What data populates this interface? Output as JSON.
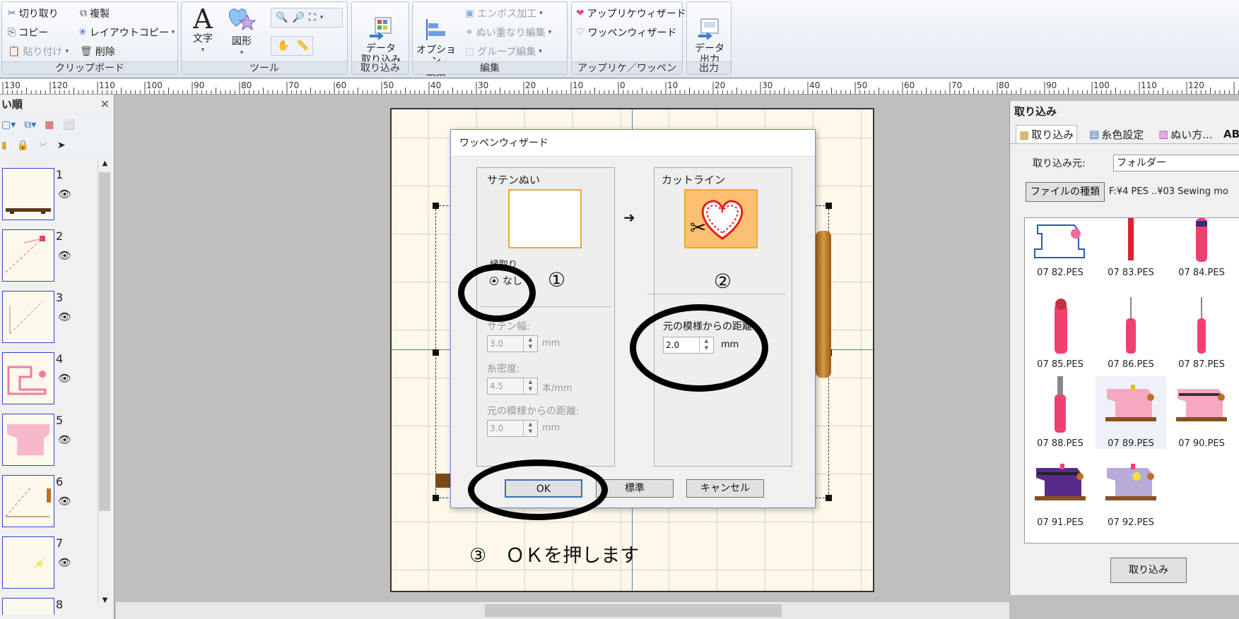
{
  "ribbon": {
    "clipboard": {
      "cut": "切り取り",
      "duplicate": "複製",
      "copy": "コピー",
      "layout_copy": "レイアウトコピー",
      "paste": "貼り付け",
      "delete": "削除",
      "label": "クリップボード"
    },
    "tools": {
      "text": "文字",
      "shape": "図形",
      "label": "ツール"
    },
    "import": {
      "data_import": "データ\n取り込み",
      "label": "取り込み"
    },
    "edit": {
      "options_edit": "オプション\n編集",
      "emboss": "エンボス加工",
      "overlap": "ぬい重なり編集",
      "group": "グループ編集",
      "label": "編集"
    },
    "applique": {
      "applique_wizard": "アップリケウィザード",
      "patch_wizard": "ワッペンウィザード",
      "label": "アップリケ／ワッペン"
    },
    "output": {
      "data_output": "データ\n出力",
      "label": "出力"
    }
  },
  "ruler": [
    "130",
    "120",
    "110",
    "100",
    "90",
    "80",
    "70",
    "60",
    "50",
    "40",
    "30",
    "20",
    "10",
    "0",
    "10",
    "20",
    "30",
    "40",
    "50",
    "60",
    "70",
    "80",
    "90",
    "100",
    "110",
    "120"
  ],
  "left_panel": {
    "title": "い順",
    "items": [
      "1",
      "2",
      "3",
      "4",
      "5",
      "6",
      "7",
      "8"
    ]
  },
  "dialog": {
    "title": "ワッペンウィザード",
    "satin": {
      "title": "サテンぬい",
      "frame_label": "縁取り",
      "option_none": "なし",
      "width_label": "サテン幅:",
      "width_value": "3.0",
      "density_label": "糸密度:",
      "density_value": "4.5",
      "density_unit": "本/mm",
      "distance_label": "元の模様からの距離:",
      "distance_value": "3.0",
      "unit": "mm"
    },
    "arrow": "➜",
    "cutline": {
      "title": "カットライン",
      "distance_label": "元の模様からの距離:",
      "distance_value": "2.0",
      "unit": "mm"
    },
    "buttons": {
      "ok": "OK",
      "default": "標準",
      "cancel": "キャンセル"
    },
    "marker_1": "①",
    "marker_2": "②"
  },
  "instruction": "③　ＯＫを押します",
  "right_panel": {
    "title": "取り込み",
    "tabs": [
      "取り込み",
      "糸色設定",
      "ぬい方...",
      "AB"
    ],
    "source_label": "取り込み元:",
    "source_value": "フォルダー",
    "file_type_button": "ファイルの種類",
    "path": "F:¥4 PES ..¥03 Sewing mo",
    "files": [
      "07 82.PES",
      "07 83.PES",
      "07 84.PES",
      "07 85.PES",
      "07 86.PES",
      "07 87.PES",
      "07 88.PES",
      "07 89.PES",
      "07 90.PES",
      "07 91.PES",
      "07 92.PES"
    ],
    "import_button": "取り込み"
  }
}
